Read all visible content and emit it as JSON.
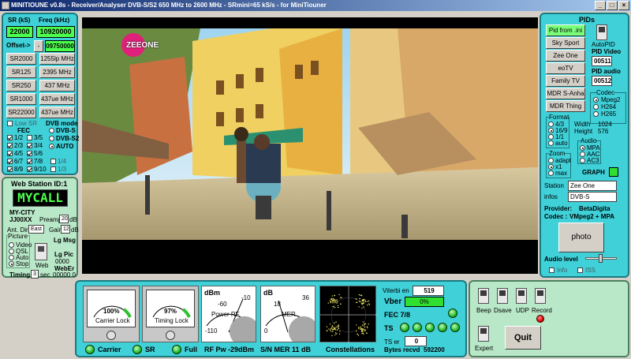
{
  "window": {
    "title": "MINITIOUNE v0.8s - Receiver/Analyser DVB-S/S2 650 MHz to 2600 MHz - SRmini=65 kS/s - for MiniTiouner",
    "buttons": [
      "_",
      "□",
      "×"
    ]
  },
  "left": {
    "sr_label": "SR (kS)",
    "freq_label": "Freq (kHz)",
    "sr_value": "22000",
    "freq_value": "10920000",
    "offset_label": "Offset->",
    "offset_sign": "-",
    "offset_value": "09750000",
    "presets": [
      {
        "sr": "SR2000",
        "freq": "1255lp MHz"
      },
      {
        "sr": "SR125",
        "freq": "2395 MHz"
      },
      {
        "sr": "SR250",
        "freq": "437 MHz"
      },
      {
        "sr": "SR1000",
        "freq": "437ue MHz"
      },
      {
        "sr": "SR22000",
        "freq": "437ue MHz"
      }
    ],
    "low_sr": "Low SR",
    "fec_title": "FEC",
    "dvb_title": "DVB mode",
    "fec": [
      {
        "a": "1/2",
        "a_on": true,
        "b": "3/5",
        "b_on": false,
        "c": "1/4",
        "c_on": false
      },
      {
        "a": "2/3",
        "a_on": true,
        "b": "3/4",
        "b_on": true,
        "c": "1/3",
        "c_on": false
      },
      {
        "a": "4/5",
        "a_on": true,
        "b": "5/6",
        "b_on": true,
        "c": "2/5",
        "c_on": false
      },
      {
        "a": "6/7",
        "a_on": true,
        "b": "7/8",
        "b_on": true,
        "c": "",
        "c_on": false
      },
      {
        "a": "8/9",
        "a_on": true,
        "b": "9/10",
        "b_on": true,
        "c": "",
        "c_on": false
      }
    ],
    "dvb_modes": [
      "DVB-S",
      "DVB-S2",
      "AUTO"
    ],
    "dvb_selected": 2
  },
  "station": {
    "title": "Web Station ID:1",
    "call": "MYCALL",
    "city": "MY-CITY",
    "locator": "JJ00XX",
    "preamp_label": "Preamp",
    "preamp_value": "20",
    "db": "dB",
    "ant_label": "Ant. Dir.",
    "ant_value": "East",
    "gain_label": "Gain",
    "gain_value": "12",
    "picture_label": "Picture",
    "pictures": [
      "Video",
      "QSL",
      "Auto",
      "Stop"
    ],
    "picture_selected": 3,
    "web_label": "Web",
    "lgmsg": "Lg Msg",
    "lgpic": "Lg Pic",
    "lgpic_val": "0000",
    "weberr": "WebEr",
    "weberr_val": "00000 0",
    "timing_label": "Timing",
    "timing_value": "3",
    "sec": "sec"
  },
  "right": {
    "title": "PIDs",
    "pid_buttons": [
      "Pid from .ini",
      "Sky Sport",
      "Zee One",
      "eoTV",
      "Family TV",
      "MDR S-Anha",
      "MDR Thing"
    ],
    "autopid": "AutoPID",
    "pid_video_label": "PID Video",
    "pid_video": "00511",
    "pid_audio_label": "PID audio",
    "pid_audio": "00512",
    "codec_label": "Codec",
    "codecs": [
      "Mpeg2",
      "H264",
      "H265"
    ],
    "codec_selected": 0,
    "format_label": "Format",
    "formats": [
      "4/3",
      "16/9",
      "1/1",
      "auto"
    ],
    "format_selected": 1,
    "width_label": "Width",
    "width_value": "1024",
    "height_label": "Height",
    "height_value": "576",
    "audio_label": "Audio",
    "audios": [
      "MPA",
      "AAC",
      "AC3"
    ],
    "audio_selected": 0,
    "zoom_label": "Zoom",
    "zooms": [
      "adapt",
      "x1",
      "max"
    ],
    "zoom_selected": 1,
    "graph": "GRAPH",
    "station_label": "Station",
    "station_value": "Zee One",
    "infos_label": "infos",
    "infos_value": "DVB-S",
    "provider_label": "Provider:",
    "provider_value": "BetaDigita",
    "codec_row_label": "Codec :",
    "codec_row_value": "VMpeg2 + MPA",
    "photo": "photo",
    "audio_level": "Audio level",
    "info": "Info",
    "iss": "ISS"
  },
  "video": {
    "logo": "ZEEONE"
  },
  "bottom": {
    "carrier_pct": "100%",
    "carrier_label": "Carrier Lock",
    "carrier_fill": 1.0,
    "timing_pct": "97%",
    "timing_label": "Timing Lock",
    "timing_fill": 0.97,
    "power_unit": "dBm",
    "power_ticks": [
      "-60",
      "-10",
      "-110"
    ],
    "power_label": "Power RF",
    "mer_unit": "dB",
    "mer_ticks": [
      "18",
      "36",
      "0"
    ],
    "mer_label": "MER",
    "status": [
      "Carrier",
      "SR",
      "Full"
    ],
    "rf_pw": "RF Pw -29dBm",
    "sn_mer": "S/N MER  11 dB",
    "constellations": "Constellations",
    "viterbi_label": "Viterbi en",
    "viterbi_value": "519",
    "vber_label": "Vber",
    "vber_value": "0%",
    "fec_label": "FEC 7/8",
    "ts_label": "TS",
    "ts_err_label": "TS er",
    "ts_err_value": "0",
    "bytes_label": "Bytes recvd",
    "bytes_value": "592200"
  },
  "controls": {
    "beep": "Beep",
    "dsave": "Dsave",
    "udp": "UDP",
    "record": "Record",
    "expert": "Expert",
    "quit": "Quit"
  }
}
